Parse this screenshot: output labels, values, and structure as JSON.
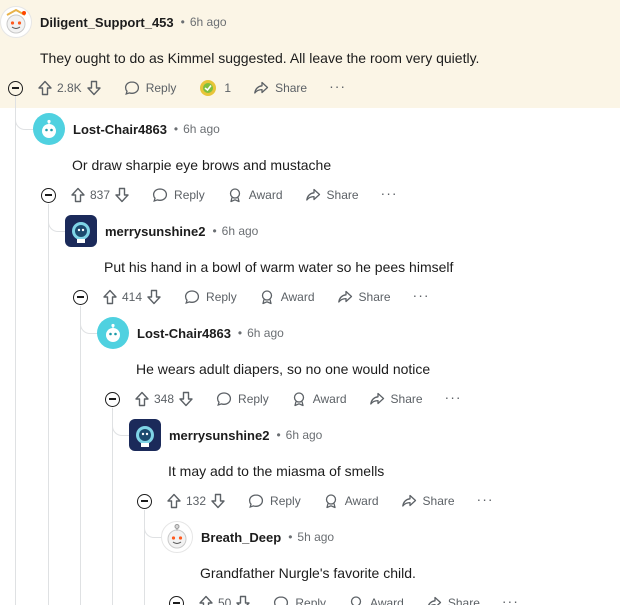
{
  "labels": {
    "reply": "Reply",
    "award": "Award",
    "share": "Share",
    "more": "···",
    "dot": "•"
  },
  "comments": [
    {
      "username": "Diligent_Support_453",
      "time": "6h ago",
      "text": "They ought to do as Kimmel suggested. All leave the room very quietly.",
      "votes": "2.8K",
      "award_count": "1"
    },
    {
      "username": "Lost-Chair4863",
      "time": "6h ago",
      "text": "Or draw sharpie eye brows and mustache",
      "votes": "837"
    },
    {
      "username": "merrysunshine2",
      "time": "6h ago",
      "text": "Put his hand in a bowl of warm water so he pees himself",
      "votes": "414"
    },
    {
      "username": "Lost-Chair4863",
      "time": "6h ago",
      "text": "He wears adult diapers, so no one would notice",
      "votes": "348"
    },
    {
      "username": "merrysunshine2",
      "time": "6h ago",
      "text": "It may add to the miasma of smells",
      "votes": "132"
    },
    {
      "username": "Breath_Deep",
      "time": "5h ago",
      "text": "Grandfather Nurgle's favorite child.",
      "votes": "50"
    }
  ]
}
